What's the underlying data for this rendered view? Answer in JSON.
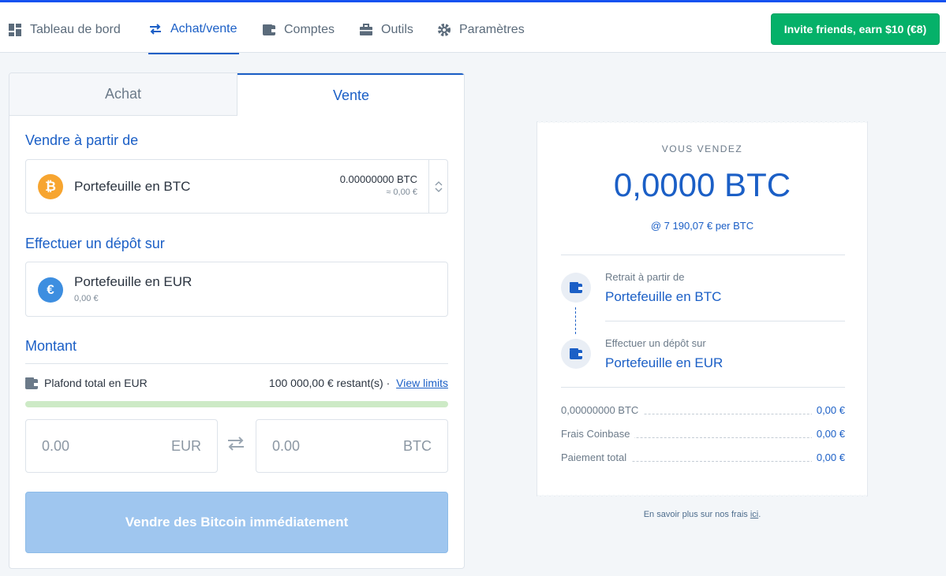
{
  "nav": {
    "items": [
      {
        "label": "Tableau de bord",
        "icon": "dashboard-icon"
      },
      {
        "label": "Achat/vente",
        "icon": "swap-arrows-icon"
      },
      {
        "label": "Comptes",
        "icon": "wallet-icon"
      },
      {
        "label": "Outils",
        "icon": "briefcase-icon"
      },
      {
        "label": "Paramètres",
        "icon": "gear-icon"
      }
    ],
    "active": "Achat/vente",
    "invite_label": "Invite friends, earn $10 (€8)"
  },
  "colors": {
    "accent": "#1b5fc6",
    "green": "#05b169",
    "btc": "#f7a530",
    "eur": "#3d8ee0"
  },
  "trade": {
    "tabs": [
      {
        "label": "Achat"
      },
      {
        "label": "Vente"
      }
    ],
    "active_tab": "Vente",
    "from_label": "Vendre à partir de",
    "from_wallet": {
      "name": "Portefeuille en BTC",
      "balance": "0.00000000 BTC",
      "approx": "≈ 0,00 €",
      "icon": "bitcoin-icon"
    },
    "to_label": "Effectuer un dépôt sur",
    "to_wallet": {
      "name": "Portefeuille en EUR",
      "balance": "0,00 €",
      "icon": "euro-icon"
    },
    "amount_label": "Montant",
    "limit_label": "Plafond total en EUR",
    "limit_remaining": "100 000,00 € restant(s) ·",
    "view_limits": "View limits",
    "limit_used_fraction": 0.0,
    "eur_input": {
      "value": "0.00",
      "currency": "EUR"
    },
    "btc_input": {
      "value": "0.00",
      "currency": "BTC"
    },
    "submit_label": "Vendre des Bitcoin immédiatement"
  },
  "receipt": {
    "heading": "VOUS VENDEZ",
    "amount": "0,0000 BTC",
    "rate": "@ 7 190,07 € per BTC",
    "from_small": "Retrait à partir de",
    "from_big": "Portefeuille en BTC",
    "to_small": "Effectuer un dépôt sur",
    "to_big": "Portefeuille en EUR",
    "rows": [
      {
        "label": "0,00000000 BTC",
        "value": "0,00 €"
      },
      {
        "label": "Frais Coinbase",
        "value": "0,00 €"
      },
      {
        "label": "Paiement total",
        "value": "0,00 €"
      }
    ],
    "footnote_text": "En savoir plus sur nos frais",
    "footnote_link": "ici",
    "footnote_end": "."
  }
}
